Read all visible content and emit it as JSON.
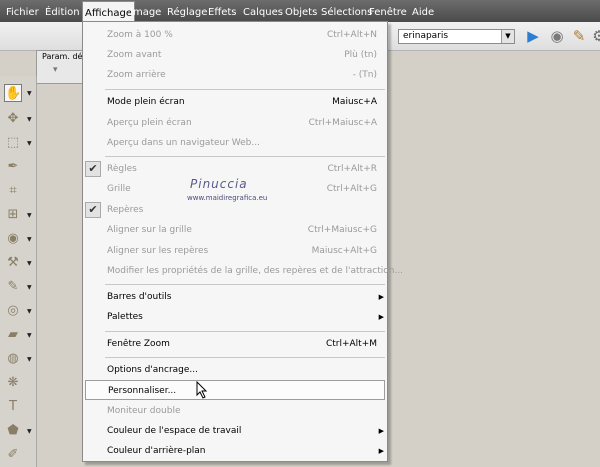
{
  "menubar": {
    "items": [
      "Fichier",
      "Édition",
      "Affichage",
      "Image",
      "Réglage",
      "Effets",
      "Calques",
      "Objets",
      "Sélections",
      "Fenêtre",
      "Aide"
    ],
    "active": "Affichage"
  },
  "toolbar": {
    "workspace_value": "erinaparis",
    "icons": [
      "play-icon",
      "stop-icon",
      "edit-script-icon",
      "script-extra-icon"
    ]
  },
  "tool_options": {
    "label": "Param. déf"
  },
  "menu": {
    "items": [
      {
        "label": "Zoom à 100 %",
        "shortcut": "Ctrl+Alt+N",
        "disabled": true
      },
      {
        "label": "Zoom avant",
        "shortcut": "Plù (tn)",
        "disabled": true
      },
      {
        "label": "Zoom arrière",
        "shortcut": "- (Tn)",
        "disabled": true
      },
      {
        "label": "Mode plein écran",
        "shortcut": "Maiusc+A",
        "disabled": false
      },
      {
        "label": "Aperçu plein écran",
        "shortcut": "Ctrl+Maiusc+A",
        "disabled": true
      },
      {
        "label": "Aperçu dans un navigateur Web...",
        "shortcut": "",
        "disabled": true
      },
      {
        "label": "Règles",
        "shortcut": "Ctrl+Alt+R",
        "disabled": true,
        "checked": true
      },
      {
        "label": "Grille",
        "shortcut": "Ctrl+Alt+G",
        "disabled": true
      },
      {
        "label": "Repères",
        "shortcut": "",
        "disabled": true,
        "checked": true
      },
      {
        "label": "Aligner sur la grille",
        "shortcut": "Ctrl+Maiusc+G",
        "disabled": true
      },
      {
        "label": "Aligner sur les repères",
        "shortcut": "Maiusc+Alt+G",
        "disabled": true
      },
      {
        "label": "Modifier les propriétés de la grille, des repères et de l'attraction...",
        "shortcut": "",
        "disabled": true
      },
      {
        "label": "Barres d'outils",
        "shortcut": "",
        "disabled": false,
        "submenu": true
      },
      {
        "label": "Palettes",
        "shortcut": "",
        "disabled": false,
        "submenu": true
      },
      {
        "label": "Fenêtre Zoom",
        "shortcut": "Ctrl+Alt+M",
        "disabled": false
      },
      {
        "label": "Options d'ancrage...",
        "shortcut": "",
        "disabled": false
      },
      {
        "label": "Personnaliser...",
        "shortcut": "",
        "disabled": false,
        "highlighted": true
      },
      {
        "label": "Moniteur double",
        "shortcut": "",
        "disabled": true
      },
      {
        "label": "Couleur de l'espace de travail",
        "shortcut": "",
        "disabled": false,
        "submenu": true
      },
      {
        "label": "Couleur d'arrière-plan",
        "shortcut": "",
        "disabled": false,
        "submenu": true
      }
    ]
  },
  "watermark": {
    "name": "Pinuccia",
    "site": "www.maidiregrafica.eu"
  },
  "colors": {
    "menubar": "#555555",
    "menu_bg": "#f6f6f6",
    "disabled_text": "#9a9a9a"
  }
}
